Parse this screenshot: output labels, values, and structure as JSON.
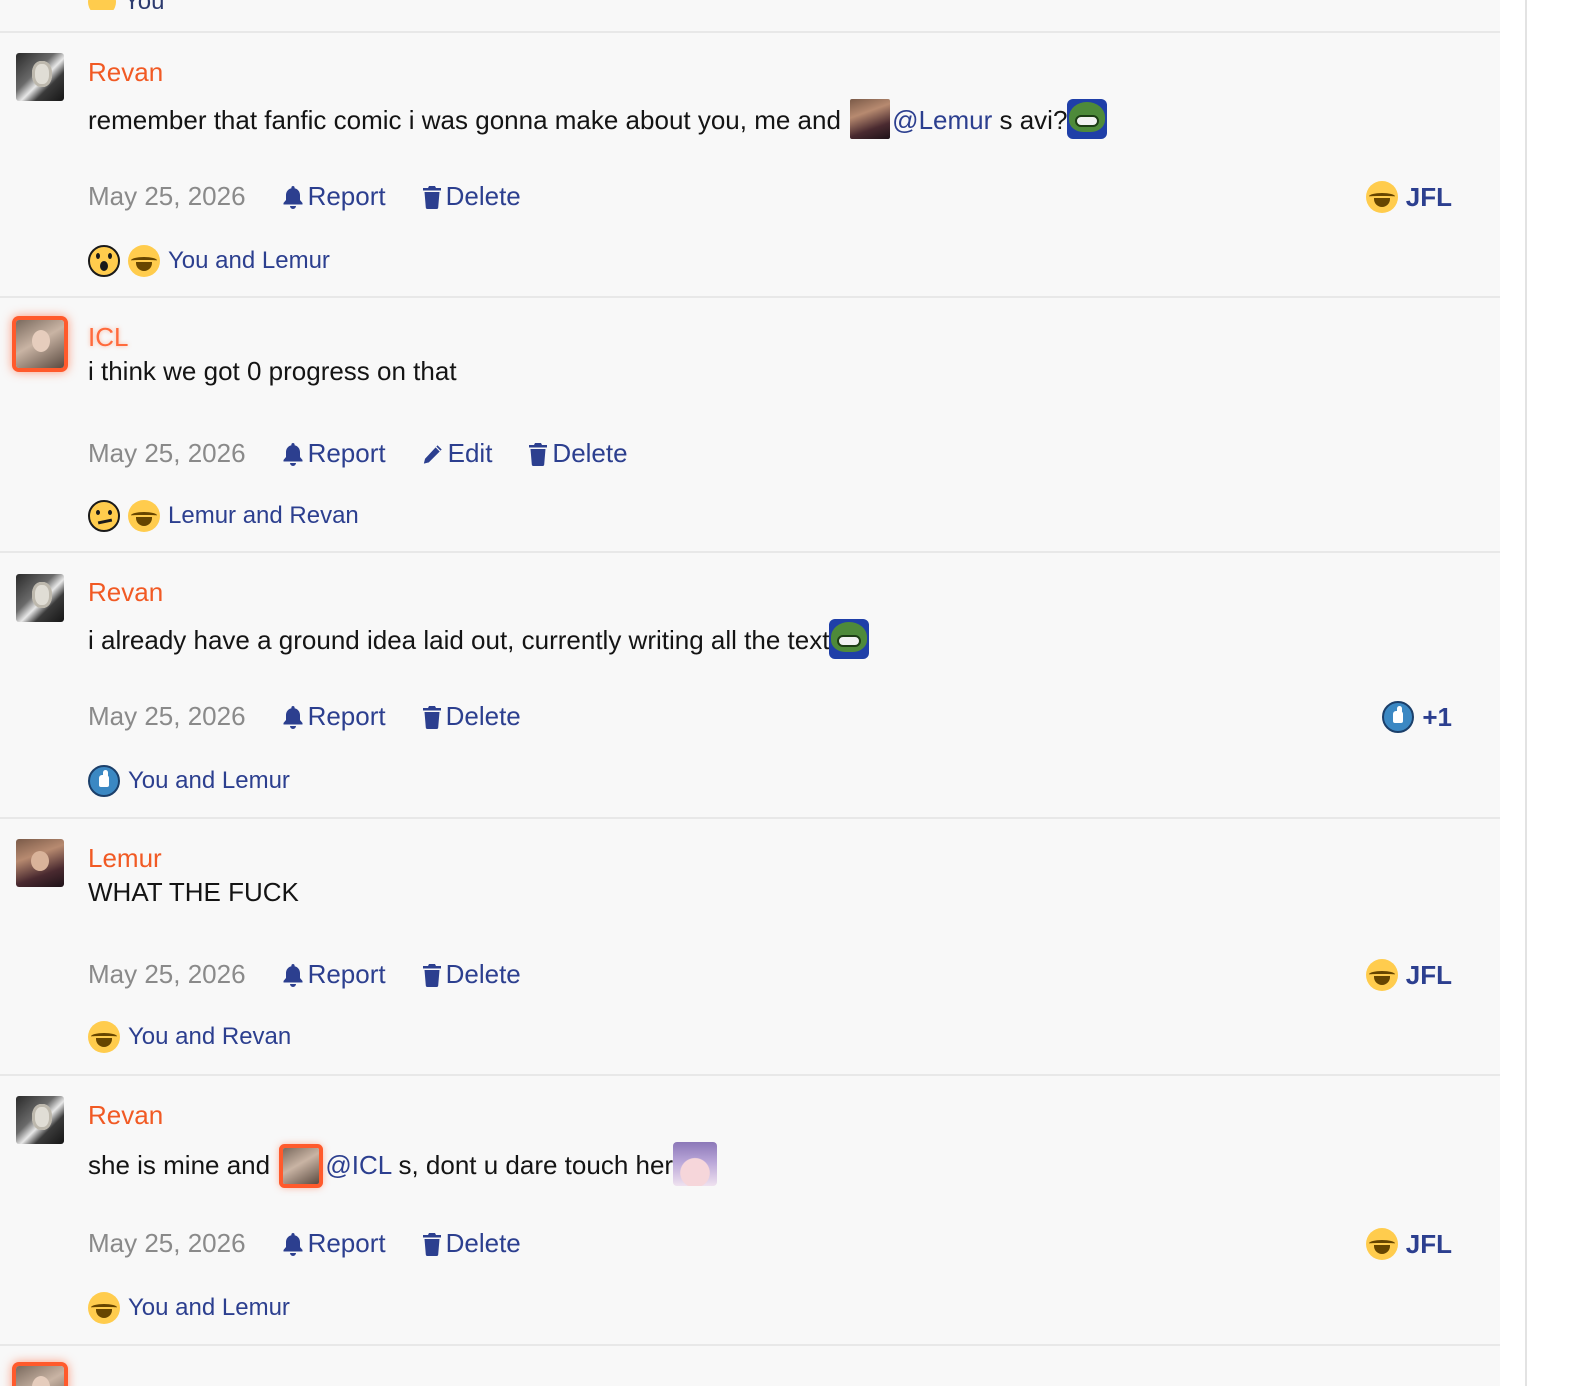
{
  "top_remnant": {
    "text": "You"
  },
  "actions": {
    "report": "Report",
    "edit": "Edit",
    "delete": "Delete"
  },
  "messages": [
    {
      "author": "Revan",
      "text_before": "remember that fanfic comic i was gonna make about you, me and",
      "mention": "@Lemur",
      "text_after": " s avi?",
      "date": "May 25, 2026",
      "badge": {
        "emoji": "joy-icon",
        "label": "JFL"
      },
      "reactions": {
        "emojis": [
          "wow-icon",
          "joy-icon"
        ],
        "text": "You and Lemur"
      }
    },
    {
      "author": "ICL",
      "text": "i think we got 0 progress on that",
      "date": "May 25, 2026",
      "reactions": {
        "emojis": [
          "thinking-icon",
          "joy-icon"
        ],
        "text": "Lemur and Revan"
      }
    },
    {
      "author": "Revan",
      "text": "i already have a ground idea laid out, currently writing all the text",
      "date": "May 25, 2026",
      "badge": {
        "emoji": "thumbs-up-icon",
        "label": "+1"
      },
      "reactions": {
        "emojis": [
          "thumbs-up-icon"
        ],
        "text": "You and Lemur"
      }
    },
    {
      "author": "Lemur",
      "text": "WHAT THE FUCK",
      "date": "May 25, 2026",
      "badge": {
        "emoji": "joy-icon",
        "label": "JFL"
      },
      "reactions": {
        "emojis": [
          "joy-icon"
        ],
        "text": "You and Revan"
      }
    },
    {
      "author": "Revan",
      "text_before": "she is mine and",
      "mention": "@ICL",
      "text_after": " s, dont u dare touch her",
      "date": "May 25, 2026",
      "badge": {
        "emoji": "joy-icon",
        "label": "JFL"
      },
      "reactions": {
        "emojis": [
          "joy-icon"
        ],
        "text": "You and Lemur"
      }
    }
  ]
}
